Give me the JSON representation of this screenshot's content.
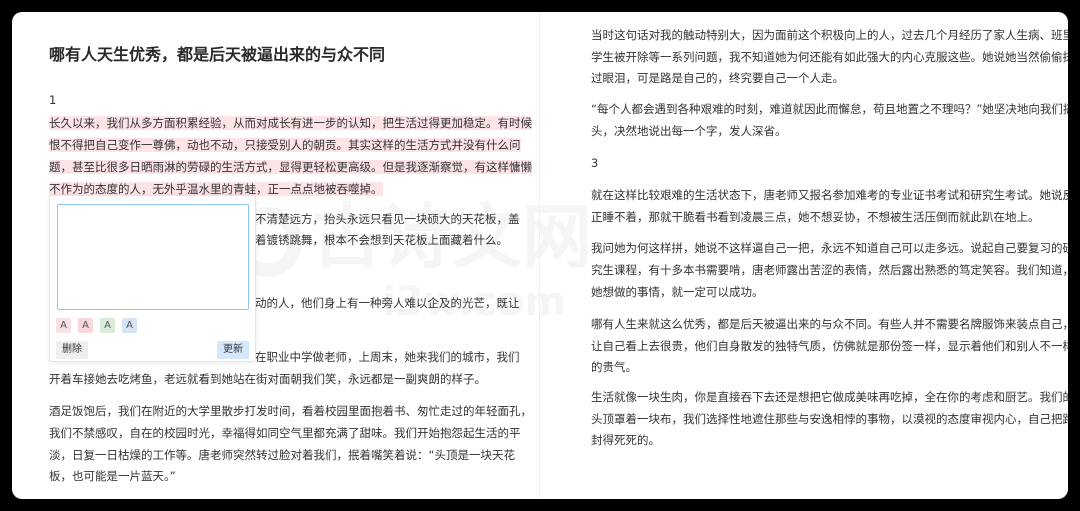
{
  "watermark": {
    "main": "古诗文网",
    "sub": "i3w.com"
  },
  "left": {
    "title": "哪有人天生优秀，都是后天被逼出来的与众不同",
    "section_number": "1",
    "highlighted_lines": [
      "长久以来，我们从多方面积累经验，从而对成长有进一步的认知，把生活过得更加稳定。有时候",
      "恨不得把自己变作一尊佛，动也不动，只接受别人的朝贡。其实这样的生活方式并没有什么问",
      "题，甚至比很多日晒雨淋的劳碌的生活方式，显得更轻松更高级。但是我逐渐察觉，有这样慵懒",
      "不作为的态度的人，无外乎温水里的青蛙，正一点点地被吞噬掉。"
    ],
    "partial_lines": [
      "不清楚远方，抬头永远只看见一块硕大的天花板，盖",
      "着镀锈跳舞，根本不会想到天花板上面藏着什么。",
      "动的人，他们身上有一种旁人难以企及的光芒，既让",
      "在职业中学做老师，上周末，她来我们的城市，我们"
    ],
    "lines": [
      "开着车接她去吃烤鱼，老远就看到她站在街对面朝我们笑，永远都是一副爽朗的样子。",
      "酒足饭饱后，我们在附近的大学里散步打发时间，看着校园里面抱着书、匆忙走过的年轻面孔，",
      "我们不禁感叹，自在的校园时光，幸福得如同空气里都充满了甜味。我们开始抱怨起生活的平",
      "淡，日复一日枯燥的工作等。唐老师突然转过脸对着我们，抿着嘴笑着说：“头顶是一块天花",
      "板，也可能是一片蓝天。”"
    ],
    "note_popup": {
      "textarea_value": "",
      "color_options": [
        {
          "label": "A",
          "color": "#f7e1e4"
        },
        {
          "label": "A",
          "color": "#f8d7da"
        },
        {
          "label": "A",
          "color": "#d8ecd9"
        },
        {
          "label": "A",
          "color": "#d6e4f5"
        }
      ],
      "delete_label": "删除",
      "update_label": "更新"
    }
  },
  "right": {
    "lines": [
      "当时这句话对我的触动特别大，因为面前这个积极向上的人，过去几个月经历了家人生病、班里",
      "学生被开除等一系列问题，我不知道她为何还能有如此强大的内心克服这些。她说她当然偷偷抹",
      "过眼泪，可是路是自己的，终究要自己一个人走。",
      "“每个人都会遇到各种艰难的时刻，难道就因此而懈怠，苟且地置之不理吗？”她坚决地向我们摇",
      "头，决然地说出每一个字，发人深省。",
      "3",
      "就在这样比较艰难的生活状态下，唐老师又报名参加难考的专业证书考试和研究生考试。她说反",
      "正睡不着，那就干脆看书看到凌晨三点，她不想妥协，不想被生活压倒而就此趴在地上。",
      "我问她为何这样拼，她说不这样逼自己一把，永远不知道自己可以走多远。说起自己要复习的研",
      "究生课程，有十多本书需要啃，唐老师露出苦涩的表情，然后露出熟悉的笃定笑容。我们知道，",
      "她想做的事情，就一定可以成功。",
      "哪有人生来就这么优秀，都是后天被逼出来的与众不同。有些人并不需要名牌服饰来装点自己，",
      "让自己看上去很贵，他们自身散发的独特气质，仿佛就是那份签一样，显示着他们和别人不一样",
      "的贵气。",
      "生活就像一块生肉，你是直接吞下去还是想把它做成美味再吃掉，全在你的考虑和厨艺。我们的",
      "头顶罩着一块布，我们选择性地遮住那些与安逸相悖的事物，以漠视的态度审视内心，自己把路",
      "封得死死的。"
    ]
  }
}
